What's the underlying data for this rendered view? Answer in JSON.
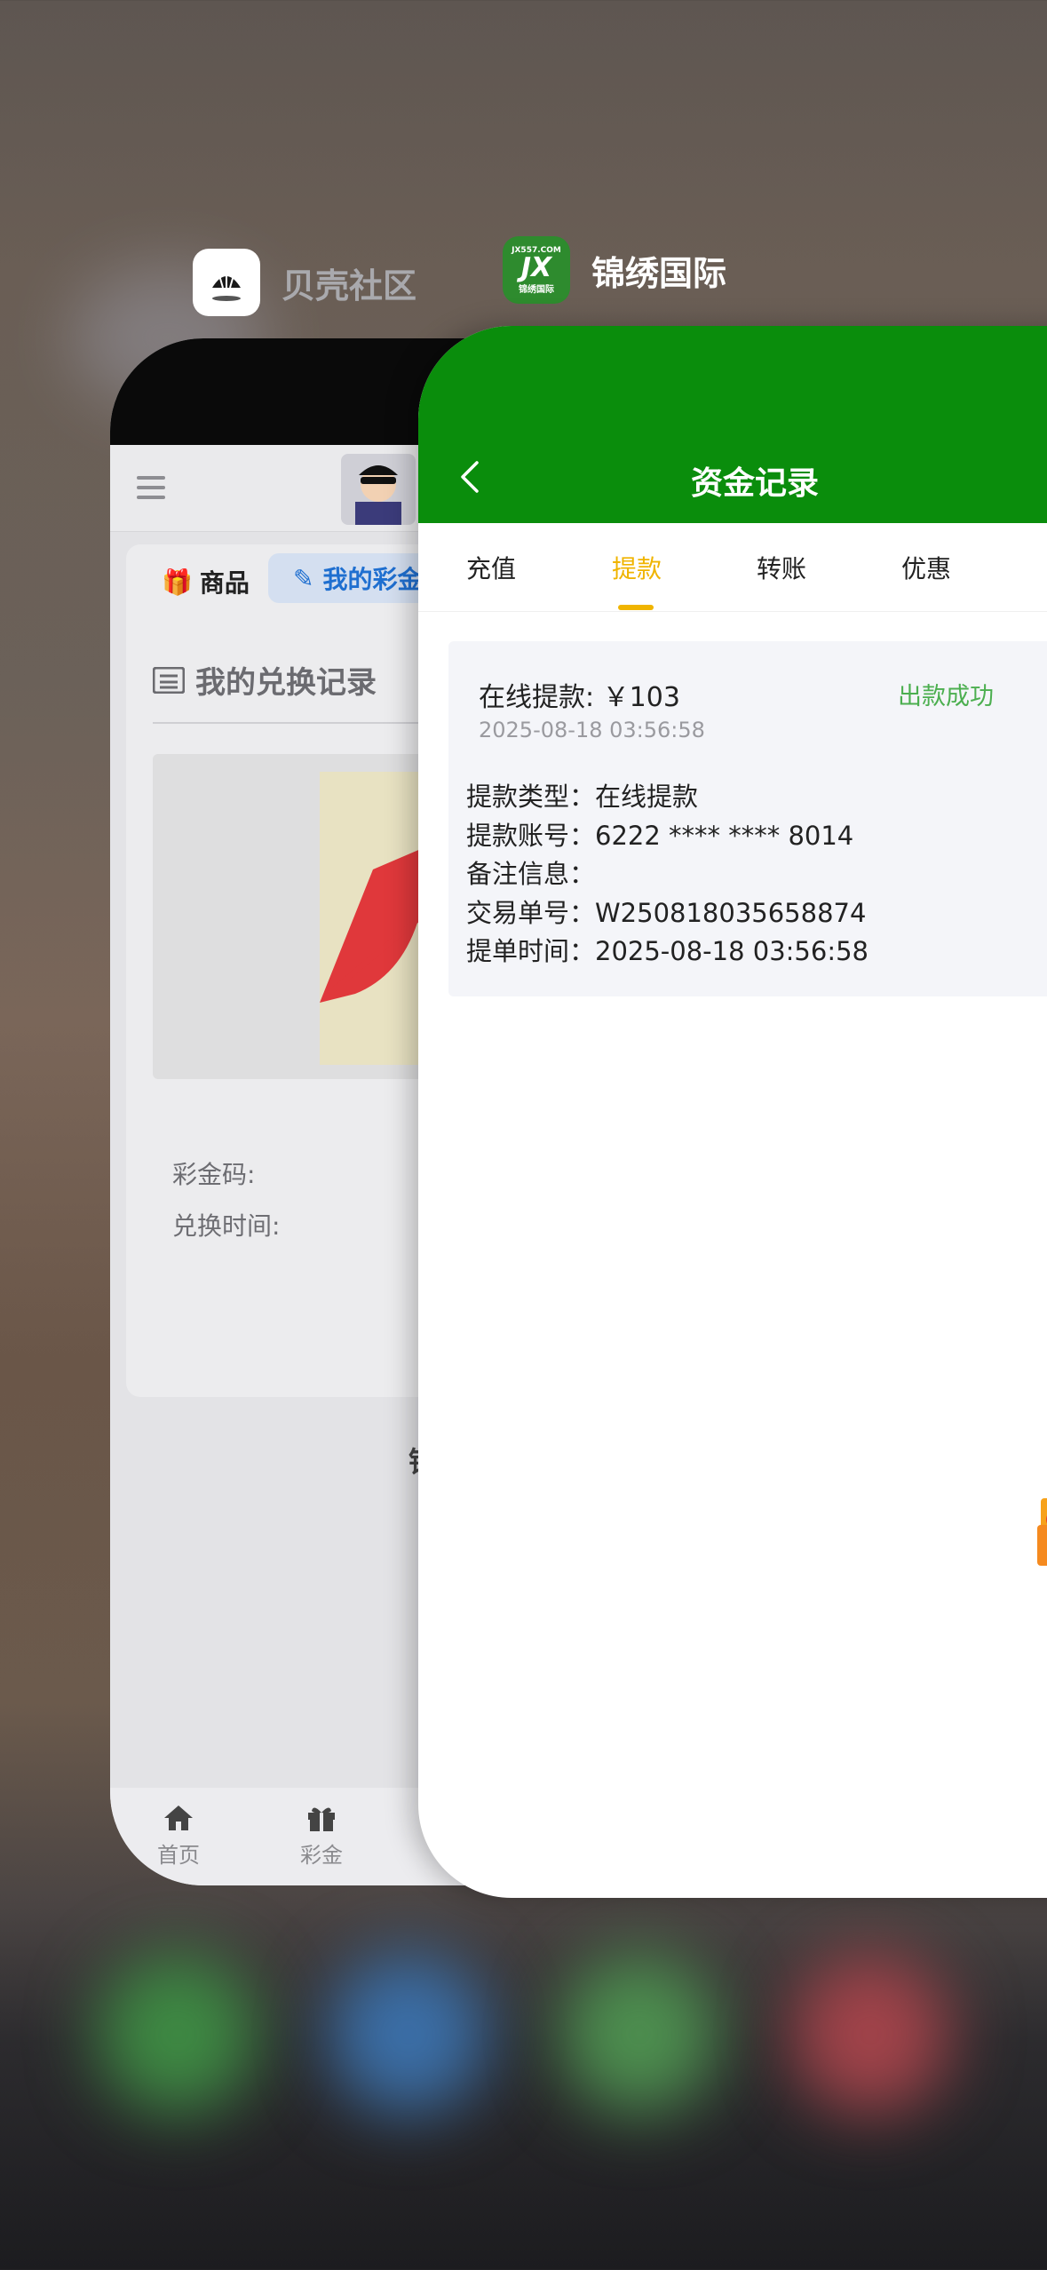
{
  "background_apps": {
    "left_app": {
      "name": "贝壳社区",
      "icon": "shell-icon"
    },
    "right_app": {
      "name": "锦绣国际",
      "icon": "jx-logo-icon",
      "icon_top_text": "JX557.COM",
      "icon_mid_text": "JX",
      "icon_bottom_text": "锦绣国际"
    }
  },
  "back_card": {
    "tabs": {
      "goods": "商品",
      "my": "我的彩金"
    },
    "section_title": "我的兑换记录",
    "cut_char": "锦",
    "fields": {
      "code_label": "彩金码:",
      "time_label": "兑换时间:"
    },
    "tabbar": [
      {
        "label": "首页",
        "icon": "home-icon"
      },
      {
        "label": "彩金",
        "icon": "gift-icon"
      }
    ]
  },
  "front_card": {
    "title": "资金记录",
    "tabs": [
      "充值",
      "提款",
      "转账",
      "优惠"
    ],
    "active_tab": "提款",
    "record": {
      "title": "在线提款: ￥103",
      "status": "出款成功",
      "date": "2025-08-18 03:56:58",
      "lines": [
        "提款类型：在线提款",
        "提款账号：6222 **** **** 8014",
        "备注信息：",
        "交易单号：W250818035658874",
        "提单时间：2025-08-18 03:56:58"
      ]
    }
  },
  "colors": {
    "front_header": "#0a8d0c",
    "active_tab": "#f0b400",
    "status_success": "#4caf50",
    "back_active_tab": "#1f6fd0"
  }
}
